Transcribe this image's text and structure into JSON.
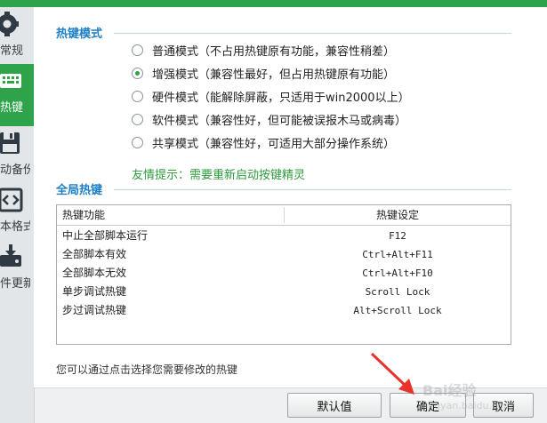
{
  "sidebar": {
    "items": [
      {
        "label": "常规",
        "icon": "gear-icon"
      },
      {
        "label": "热键",
        "icon": "keyboard-icon",
        "active": true
      },
      {
        "label": "动备份",
        "icon": "floppy-disk-icon"
      },
      {
        "label": "本格式",
        "icon": "code-brackets-icon"
      },
      {
        "label": "件更新",
        "icon": "update-download-icon"
      }
    ]
  },
  "hotkey_mode": {
    "title": "热键模式",
    "options": [
      {
        "label": "普通模式（不占用热键原有功能，兼容性稍差）",
        "checked": false
      },
      {
        "label": "增强模式（兼容性最好，但占用热键原有功能）",
        "checked": true
      },
      {
        "label": "硬件模式（能解除屏蔽，只适用于win2000以上）",
        "checked": false
      },
      {
        "label": "软件模式（兼容性好，但可能被误报木马或病毒）",
        "checked": false
      },
      {
        "label": "共享模式（兼容性好，可适用大部分操作系统）",
        "checked": false
      }
    ],
    "hint": "友情提示：需要重新启动按键精灵"
  },
  "global_hotkeys": {
    "title": "全局热键",
    "columns": [
      "热键功能",
      "热键设定"
    ],
    "rows": [
      {
        "function": "中止全部脚本运行",
        "key": "F12"
      },
      {
        "function": "全部脚本有效",
        "key": "Ctrl+Alt+F11"
      },
      {
        "function": "全部脚本无效",
        "key": "Ctrl+Alt+F10"
      },
      {
        "function": "单步调试热键",
        "key": "Scroll Lock"
      },
      {
        "function": "步过调试热键",
        "key": "Alt+Scroll Lock"
      }
    ]
  },
  "footer_note": "您可以通过点击选择您需要修改的热键",
  "buttons": {
    "default": "默认值",
    "ok": "确定",
    "cancel": "取消"
  },
  "watermark": {
    "text": "Bai",
    "text2": "经验",
    "sub": "jingyan.baidu.com"
  },
  "colors": {
    "accent_green": "#2ea34a",
    "section_title_blue": "#1e7fc6",
    "hint_green": "#2e9b3c",
    "annotation_arrow_red": "#e8322b"
  }
}
